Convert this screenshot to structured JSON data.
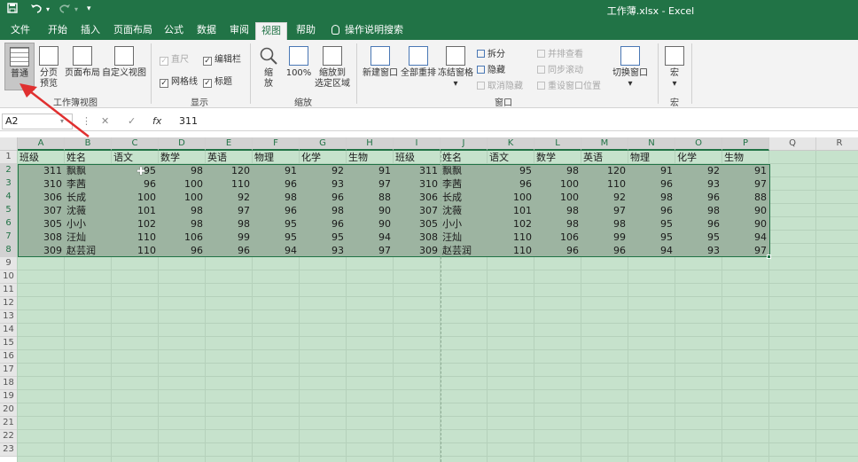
{
  "titlebar": {
    "title": "工作薄.xlsx  -  Excel",
    "save_icon": "save-icon",
    "undo_icon": "undo-icon",
    "redo_icon": "redo-icon",
    "customize_icon": "chevron-down-icon"
  },
  "tabs": [
    {
      "label": "文件"
    },
    {
      "label": "开始"
    },
    {
      "label": "插入"
    },
    {
      "label": "页面布局"
    },
    {
      "label": "公式"
    },
    {
      "label": "数据"
    },
    {
      "label": "审阅"
    },
    {
      "label": "视图",
      "active": true
    },
    {
      "label": "帮助"
    },
    {
      "label": "操作说明搜索"
    }
  ],
  "ribbon": {
    "workbook_views": {
      "group_label": "工作簿视图",
      "normal": "普通",
      "page_break_l1": "分页",
      "page_break_l2": "预览",
      "page_layout": "页面布局",
      "custom_view": "自定义视图"
    },
    "show": {
      "group_label": "显示",
      "ruler": "直尺",
      "formula_bar": "编辑栏",
      "gridlines": "网格线",
      "headings": "标题"
    },
    "zoom": {
      "group_label": "缩放",
      "zoom_l1": "缩",
      "zoom_l2": "放",
      "zoom100": "100%",
      "zoom_sel_l1": "缩放到",
      "zoom_sel_l2": "选定区域"
    },
    "window": {
      "group_label": "窗口",
      "new_window": "新建窗口",
      "arrange_all": "全部重排",
      "freeze_panes": "冻结窗格",
      "freeze_arrow": "▾",
      "split": "拆分",
      "hide": "隐藏",
      "unhide": "取消隐藏",
      "side_by_side": "并排查看",
      "sync_scroll": "同步滚动",
      "reset_pos": "重设窗口位置",
      "switch_windows": "切换窗口",
      "switch_arrow": "▾"
    },
    "macros": {
      "group_label": "宏",
      "macros": "宏",
      "macros_arrow": "▾"
    }
  },
  "formula_bar": {
    "name_box": "A2",
    "cancel": "✕",
    "enter": "✓",
    "fx": "fx",
    "value": "311"
  },
  "columns": [
    "A",
    "B",
    "C",
    "D",
    "E",
    "F",
    "G",
    "H",
    "I",
    "J",
    "K",
    "L",
    "M",
    "N",
    "O",
    "P",
    "Q",
    "R"
  ],
  "rows": [
    "1",
    "2",
    "3",
    "4",
    "5",
    "6",
    "7",
    "8",
    "9",
    "10",
    "11",
    "12",
    "13",
    "14",
    "15",
    "16",
    "17",
    "18",
    "19",
    "20",
    "21",
    "22",
    "23"
  ],
  "sheet": {
    "header": [
      "班级",
      "姓名",
      "语文",
      "数学",
      "英语",
      "物理",
      "化学",
      "生物",
      "班级",
      "姓名",
      "语文",
      "数学",
      "英语",
      "物理",
      "化学",
      "生物"
    ],
    "data": [
      [
        "311",
        "飘飘",
        "95",
        "98",
        "120",
        "91",
        "92",
        "91",
        "311",
        "飘飘",
        "95",
        "98",
        "120",
        "91",
        "92",
        "91"
      ],
      [
        "310",
        "李茜",
        "96",
        "100",
        "110",
        "96",
        "93",
        "97",
        "310",
        "李茜",
        "96",
        "100",
        "110",
        "96",
        "93",
        "97"
      ],
      [
        "306",
        "长成",
        "100",
        "100",
        "92",
        "98",
        "96",
        "88",
        "306",
        "长成",
        "100",
        "100",
        "92",
        "98",
        "96",
        "88"
      ],
      [
        "307",
        "沈薇",
        "101",
        "98",
        "97",
        "96",
        "98",
        "90",
        "307",
        "沈薇",
        "101",
        "98",
        "97",
        "96",
        "98",
        "90"
      ],
      [
        "305",
        "小小",
        "102",
        "98",
        "98",
        "95",
        "96",
        "90",
        "305",
        "小小",
        "102",
        "98",
        "98",
        "95",
        "96",
        "90"
      ],
      [
        "308",
        "汪灿",
        "110",
        "106",
        "99",
        "95",
        "95",
        "94",
        "308",
        "汪灿",
        "110",
        "106",
        "99",
        "95",
        "95",
        "94"
      ],
      [
        "309",
        "赵芸润",
        "110",
        "96",
        "96",
        "94",
        "93",
        "97",
        "309",
        "赵芸润",
        "110",
        "96",
        "96",
        "94",
        "93",
        "97"
      ]
    ]
  },
  "colors": {
    "excel_green": "#217346",
    "sheet_bg": "#c6e2cc",
    "annotation_arrow": "#e03030"
  }
}
